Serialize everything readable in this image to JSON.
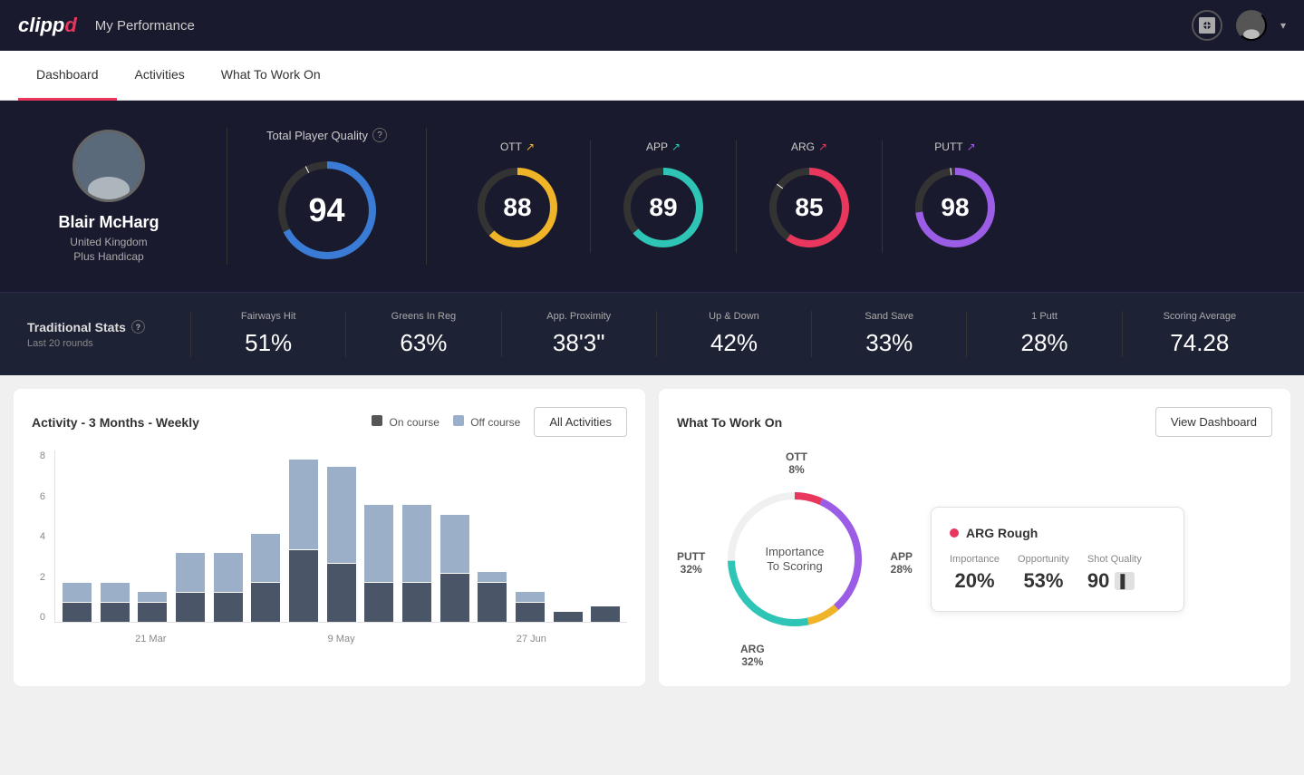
{
  "app": {
    "name": "clipp",
    "name_suffix": "d",
    "nav_title": "My Performance"
  },
  "tabs": [
    {
      "label": "Dashboard",
      "active": true
    },
    {
      "label": "Activities",
      "active": false
    },
    {
      "label": "What To Work On",
      "active": false
    }
  ],
  "player": {
    "name": "Blair McHarg",
    "country": "United Kingdom",
    "handicap": "Plus Handicap"
  },
  "total_quality": {
    "label": "Total Player Quality",
    "value": 94
  },
  "scores": [
    {
      "label": "OTT",
      "value": 88,
      "color": "#f0b429",
      "trend": "↗"
    },
    {
      "label": "APP",
      "value": 89,
      "color": "#2ec4b6",
      "trend": "↗"
    },
    {
      "label": "ARG",
      "value": 85,
      "color": "#e8365d",
      "trend": "↗"
    },
    {
      "label": "PUTT",
      "value": 98,
      "color": "#9b5de5",
      "trend": "↗"
    }
  ],
  "traditional_stats": {
    "label": "Traditional Stats",
    "period": "Last 20 rounds",
    "items": [
      {
        "name": "Fairways Hit",
        "value": "51%"
      },
      {
        "name": "Greens In Reg",
        "value": "63%"
      },
      {
        "name": "App. Proximity",
        "value": "38'3\""
      },
      {
        "name": "Up & Down",
        "value": "42%"
      },
      {
        "name": "Sand Save",
        "value": "33%"
      },
      {
        "name": "1 Putt",
        "value": "28%"
      },
      {
        "name": "Scoring Average",
        "value": "74.28"
      }
    ]
  },
  "activity_chart": {
    "title": "Activity - 3 Months - Weekly",
    "legend": [
      {
        "label": "On course",
        "color": "#555"
      },
      {
        "label": "Off course",
        "color": "#9bb0c8"
      }
    ],
    "button": "All Activities",
    "y_labels": [
      "8",
      "6",
      "4",
      "2",
      "0"
    ],
    "x_labels": [
      "21 Mar",
      "9 May",
      "27 Jun"
    ],
    "bars": [
      {
        "on": 1,
        "off": 1
      },
      {
        "on": 1,
        "off": 1
      },
      {
        "on": 1,
        "off": 0.5
      },
      {
        "on": 1.5,
        "off": 2
      },
      {
        "on": 1.5,
        "off": 2
      },
      {
        "on": 2,
        "off": 2.5
      },
      {
        "on": 4,
        "off": 5
      },
      {
        "on": 3,
        "off": 5
      },
      {
        "on": 2,
        "off": 4
      },
      {
        "on": 2,
        "off": 4
      },
      {
        "on": 2.5,
        "off": 3
      },
      {
        "on": 2,
        "off": 0.5
      },
      {
        "on": 1,
        "off": 0.5
      },
      {
        "on": 0.5,
        "off": 0
      },
      {
        "on": 0.8,
        "off": 0
      }
    ]
  },
  "what_to_work_on": {
    "title": "What To Work On",
    "button": "View Dashboard",
    "donut_center": "Importance\nTo Scoring",
    "segments": [
      {
        "label": "OTT",
        "value": "8%",
        "color": "#f0b429"
      },
      {
        "label": "APP",
        "value": "28%",
        "color": "#2ec4b6"
      },
      {
        "label": "ARG",
        "value": "32%",
        "color": "#e8365d"
      },
      {
        "label": "PUTT",
        "value": "32%",
        "color": "#9b5de5"
      }
    ],
    "highlight": {
      "name": "ARG Rough",
      "color": "#e8365d",
      "importance": "20%",
      "opportunity": "53%",
      "shot_quality": "90"
    }
  }
}
